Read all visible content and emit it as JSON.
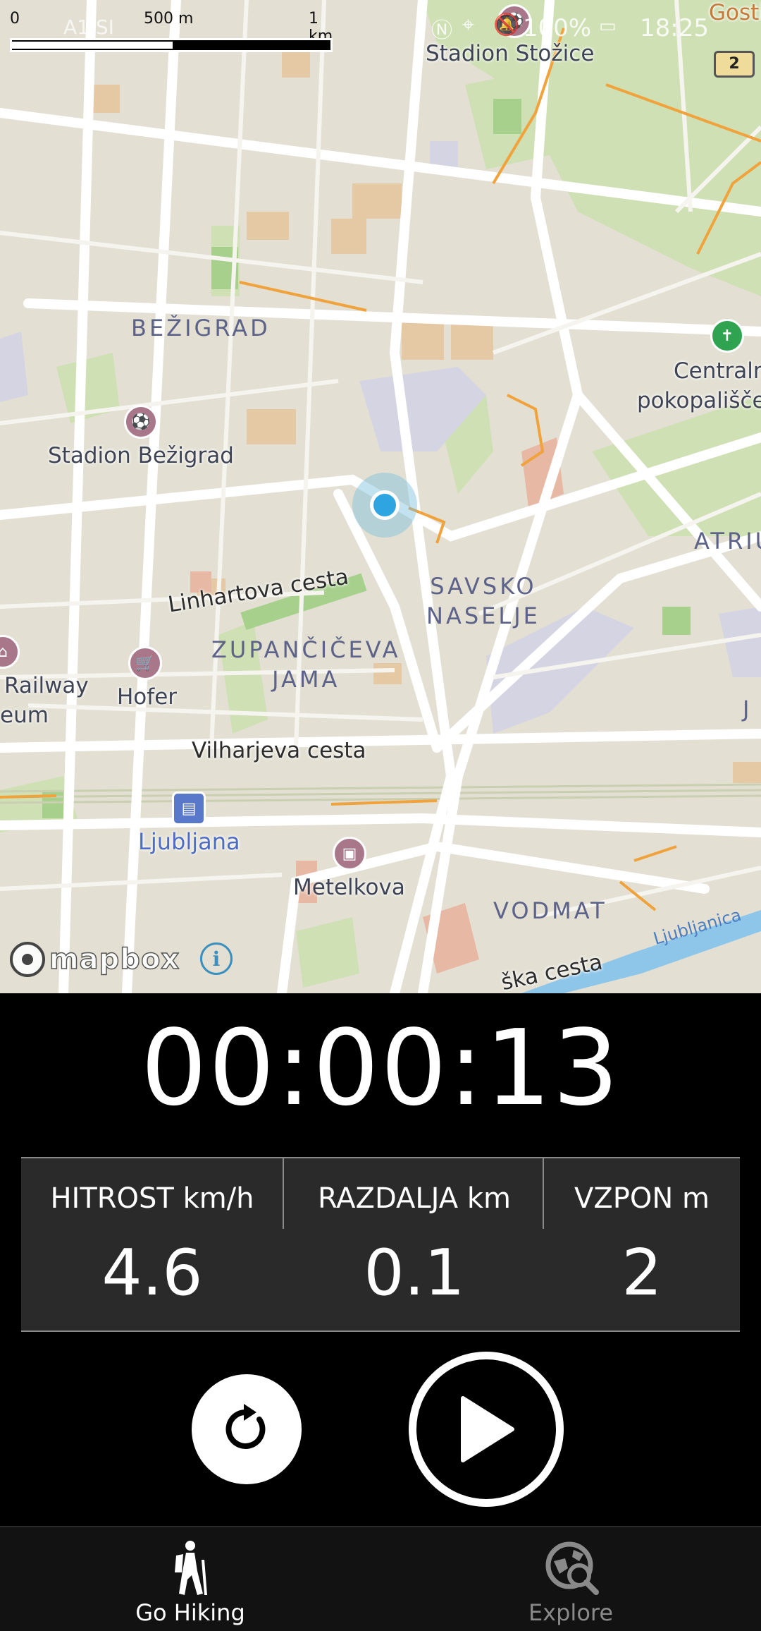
{
  "status_bar": {
    "carrier": "A1 SI",
    "battery": "100%",
    "time": "18:25"
  },
  "map": {
    "scale": {
      "zero": "0",
      "mid": "500 m",
      "end": "1 km"
    },
    "road_shield": "2",
    "districts": [
      {
        "id": "bezigrad",
        "text": "BEŽIGRAD"
      },
      {
        "id": "savsko",
        "line1": "SAVSKO",
        "line2": "NASELJE"
      },
      {
        "id": "zupanciceva",
        "line1": "ZUPANČIČEVA",
        "line2": "JAMA"
      },
      {
        "id": "vodmat",
        "text": "VODMAT"
      },
      {
        "id": "atriu",
        "text": "ATRIU"
      }
    ],
    "pois": {
      "stadion_stozice": "Stadion Stožice",
      "stadion_bezigrad": "Stadion Bežigrad",
      "hofer": "Hofer",
      "railway": "Railway",
      "eum": "eum",
      "ljubljana_station": "Ljubljana",
      "metelkova": "Metelkova",
      "centralno_1": "Centraln",
      "centralno_2": "pokopališče",
      "gosti": "Gosti",
      "j": "J"
    },
    "streets": {
      "linhartova": "Linhartova cesta",
      "vilharjeva": "Vilharjeva cesta",
      "ka_cesta": "ška cesta",
      "ljubljanica": "Ljubljanica"
    },
    "attribution": {
      "logo_text": "mapbox",
      "info": "i"
    }
  },
  "panel": {
    "timer": "00:00:13",
    "stats": [
      {
        "label": "HITROST km/h",
        "value": "4.6"
      },
      {
        "label": "RAZDALJA km",
        "value": "0.1"
      },
      {
        "label": "VZPON m",
        "value": "2"
      }
    ]
  },
  "nav": {
    "items": [
      {
        "label": "Go Hiking",
        "active": true
      },
      {
        "label": "Explore",
        "active": false
      }
    ]
  },
  "colors": {
    "accent_location": "#2ea4e0",
    "nav_active": "#ffffff",
    "nav_inactive": "#8a8a8a"
  },
  "icons": {
    "reset": "refresh-icon",
    "play": "play-icon",
    "hiking": "hiker-icon",
    "explore": "explore-icon"
  }
}
